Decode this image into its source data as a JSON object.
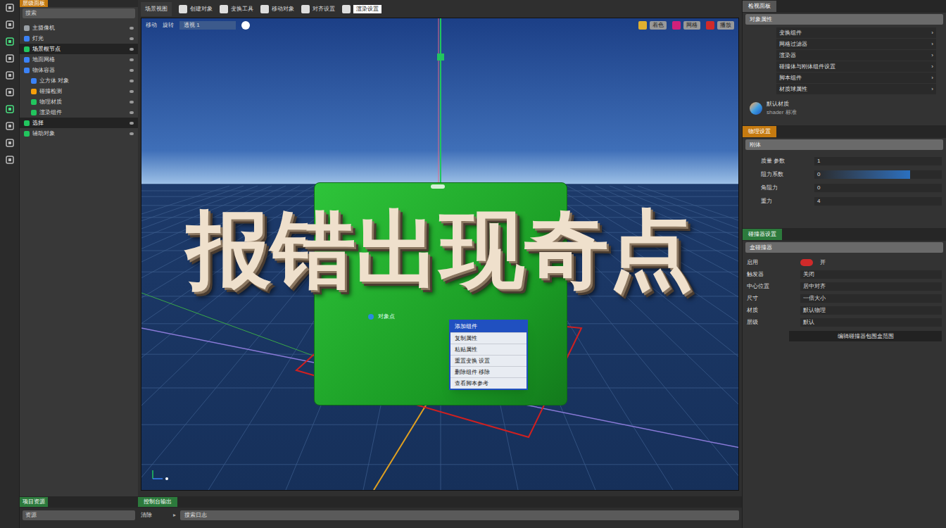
{
  "window": {
    "title": "场景视图"
  },
  "top_bar": {
    "tools": [
      {
        "label": "创建对象",
        "selected": false
      },
      {
        "label": "变换工具",
        "selected": false
      },
      {
        "label": "移动对象",
        "selected": false
      },
      {
        "label": "对齐设置",
        "selected": false
      },
      {
        "label": "渲染设置",
        "selected": true
      }
    ]
  },
  "hierarchy": {
    "title": "层级面板",
    "search": {
      "placeholder": "搜索"
    },
    "items": [
      {
        "label": "主摄像机",
        "indent": 0,
        "selected": false,
        "color": "#9aa0a6"
      },
      {
        "label": "灯光",
        "indent": 0,
        "selected": false,
        "color": "#3b82f6"
      },
      {
        "label": "场景根节点",
        "indent": 0,
        "selected": true,
        "color": "#22c55e"
      },
      {
        "label": "地面网格",
        "indent": 0,
        "selected": false,
        "color": "#3b82f6"
      },
      {
        "label": "物体容器",
        "indent": 0,
        "selected": false,
        "color": "#3b82f6"
      },
      {
        "label": "立方体 对象",
        "indent": 1,
        "selected": false,
        "color": "#3b82f6"
      },
      {
        "label": "碰撞检测",
        "indent": 1,
        "selected": false,
        "color": "#f59e0b"
      },
      {
        "label": "物理材质",
        "indent": 1,
        "selected": false,
        "color": "#22c55e"
      },
      {
        "label": "渲染组件",
        "indent": 1,
        "selected": false,
        "color": "#22c55e"
      },
      {
        "label": "选择",
        "indent": 0,
        "selected": true,
        "color": "#22c55e"
      },
      {
        "label": "辅助对象",
        "indent": 0,
        "selected": false,
        "color": "#22c55e"
      }
    ]
  },
  "project": {
    "title": "项目资源",
    "field": "资源"
  },
  "viewport": {
    "tools": [
      "移动",
      "旋转"
    ],
    "mode": "透视 1",
    "buttons": [
      "着色",
      "网格",
      "播放"
    ],
    "overlay": "报错出现奇点",
    "point_label": "对象点",
    "menu": [
      {
        "label": "添加组件",
        "selected": true
      },
      {
        "label": "复制属性",
        "selected": false
      },
      {
        "label": "粘贴属性",
        "selected": false
      },
      {
        "label": "重置变换 设置",
        "selected": false
      },
      {
        "label": "删除组件 移除",
        "selected": false
      },
      {
        "label": "查看脚本参考",
        "selected": false
      }
    ]
  },
  "console": {
    "title": "控制台输出",
    "clear": "清除",
    "field": "搜索日志"
  },
  "inspector": {
    "title": "检视面板",
    "dropdown": "对象属性",
    "rows": [
      "变换组件",
      "网格过滤器",
      "渲染器",
      "碰撞体与刚体组件设置",
      "脚本组件",
      "材质球属性"
    ],
    "asset": {
      "name": "默认材质",
      "detail": "shader 标准"
    }
  },
  "physics": {
    "title": "物理设置",
    "dropdown": "刚体",
    "props": [
      {
        "label": "质量 参数",
        "kind": "field",
        "value": "1"
      },
      {
        "label": "阻力系数",
        "kind": "slider",
        "value": "0",
        "level": 0.75
      },
      {
        "label": "角阻力",
        "kind": "field",
        "value": "0"
      },
      {
        "label": "重力",
        "kind": "field",
        "value": "4"
      }
    ]
  },
  "collider": {
    "title": "碰撞器设置",
    "dropdown": "盒碰撞器",
    "props": [
      {
        "label": "启用",
        "kind": "toggle",
        "on": true,
        "value": "开"
      },
      {
        "label": "触发器",
        "kind": "field",
        "value": "关闭"
      },
      {
        "label": "中心位置",
        "kind": "field",
        "value": "居中对齐"
      },
      {
        "label": "尺寸",
        "kind": "field",
        "value": "一倍大小"
      },
      {
        "label": "材质",
        "kind": "field",
        "value": "默认物理"
      },
      {
        "label": "层级",
        "kind": "field",
        "value": "默认"
      }
    ],
    "button": "编辑碰撞器包围盒范围"
  }
}
